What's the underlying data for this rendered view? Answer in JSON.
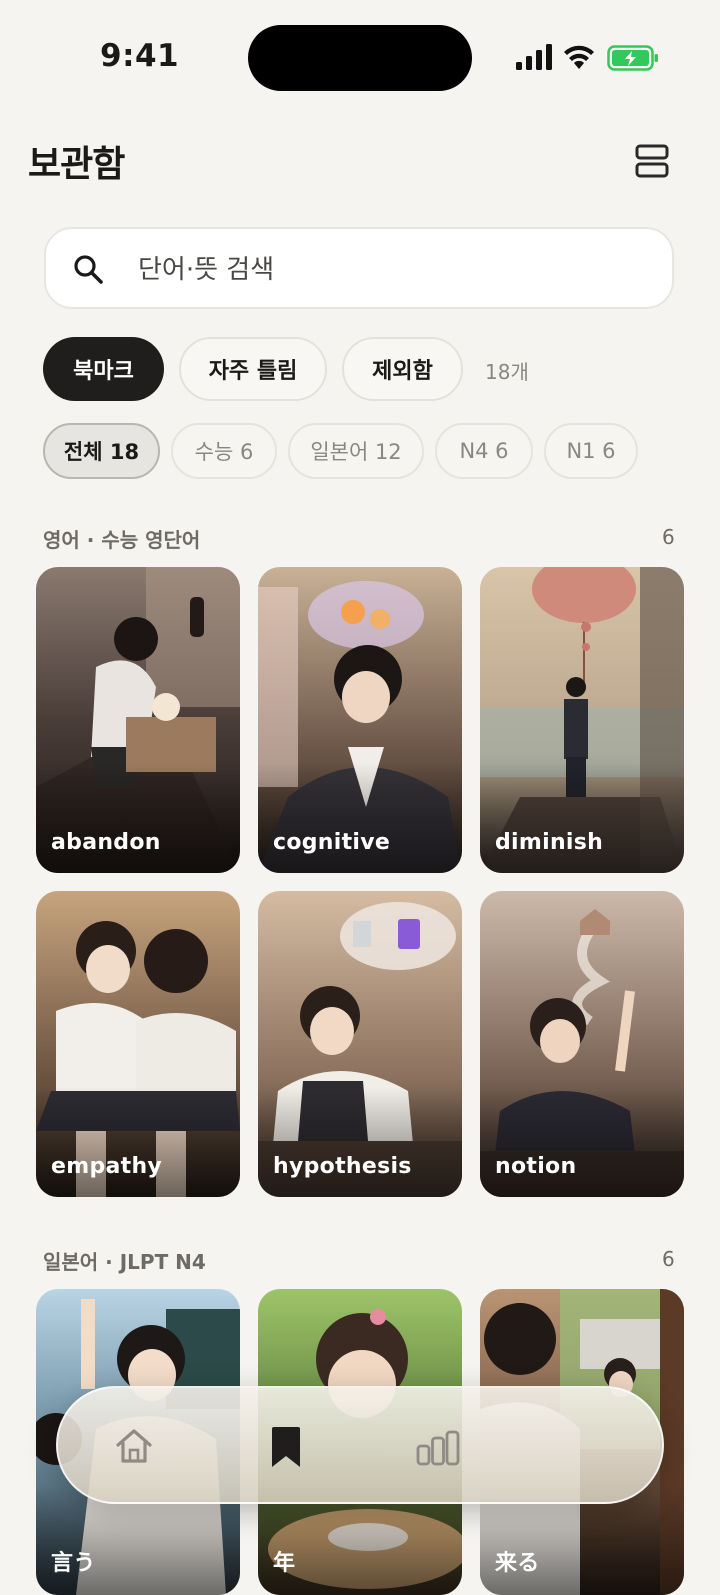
{
  "status_bar": {
    "time": "9:41"
  },
  "header": {
    "title": "보관함"
  },
  "search": {
    "placeholder": "단어·뜻 검색"
  },
  "filters": {
    "bookmark_label": "북마크",
    "wrong_label": "자주 틀림",
    "excluded_label": "제외함",
    "count_label": "18개"
  },
  "categories": [
    {
      "label": "전체 18",
      "active": true
    },
    {
      "label": "수능 6"
    },
    {
      "label": "일본어 12"
    },
    {
      "label": "N4 6"
    },
    {
      "label": "N1 6"
    }
  ],
  "sections": [
    {
      "title": "영어 · 수능 영단어",
      "count": "6",
      "cards": [
        {
          "word": "abandon"
        },
        {
          "word": "cognitive"
        },
        {
          "word": "diminish"
        },
        {
          "word": "empathy"
        },
        {
          "word": "hypothesis"
        },
        {
          "word": "notion"
        }
      ]
    },
    {
      "title": "일본어 · JLPT N4",
      "count": "6",
      "cards": [
        {
          "word": "言う"
        },
        {
          "word": "年"
        },
        {
          "word": "来る"
        }
      ]
    }
  ],
  "tab_bar": {
    "active": "bookmark",
    "icons": [
      "home-icon",
      "bookmark-icon",
      "stats-icon"
    ]
  },
  "colors": {
    "background": "#f6f4f0",
    "chip_dark": "#1f1e1d",
    "battery_green": "#34c759"
  }
}
